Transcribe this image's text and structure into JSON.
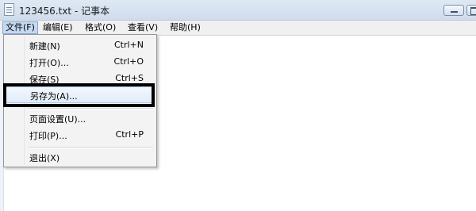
{
  "window": {
    "title": "123456.txt - 记事本"
  },
  "menubar": {
    "items": [
      {
        "label": "文件(F)"
      },
      {
        "label": "编辑(E)"
      },
      {
        "label": "格式(O)"
      },
      {
        "label": "查看(V)"
      },
      {
        "label": "帮助(H)"
      }
    ]
  },
  "file_menu": {
    "items": [
      {
        "label": "新建(N)",
        "shortcut": "Ctrl+N"
      },
      {
        "label": "打开(O)...",
        "shortcut": "Ctrl+O"
      },
      {
        "label": "保存(S)",
        "shortcut": "Ctrl+S"
      },
      {
        "label": "另存为(A)...",
        "shortcut": ""
      },
      {
        "label": "页面设置(U)...",
        "shortcut": ""
      },
      {
        "label": "打印(P)...",
        "shortcut": "Ctrl+P"
      },
      {
        "label": "退出(X)",
        "shortcut": ""
      }
    ]
  }
}
